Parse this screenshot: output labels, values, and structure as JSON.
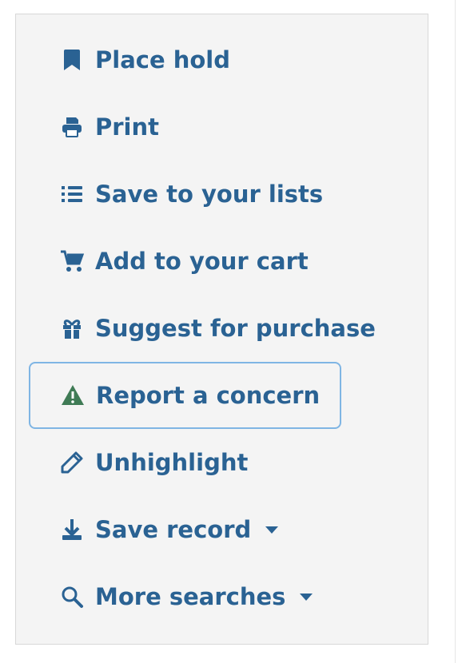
{
  "actions": [
    {
      "label": "Place hold",
      "icon": "bookmark-icon"
    },
    {
      "label": "Print",
      "icon": "print-icon"
    },
    {
      "label": "Save to your lists",
      "icon": "list-icon"
    },
    {
      "label": "Add to your cart",
      "icon": "cart-icon"
    },
    {
      "label": "Suggest for purchase",
      "icon": "gift-icon"
    },
    {
      "label": "Report a concern",
      "icon": "warning-icon"
    },
    {
      "label": "Unhighlight",
      "icon": "pencil-icon"
    },
    {
      "label": "Save record",
      "icon": "download-icon",
      "dropdown": true
    },
    {
      "label": "More searches",
      "icon": "search-icon",
      "dropdown": true
    }
  ],
  "colors": {
    "link": "#2a6293",
    "warning": "#3f7b55",
    "focus_border": "#7fb5e4",
    "panel_bg": "#f4f4f4"
  }
}
